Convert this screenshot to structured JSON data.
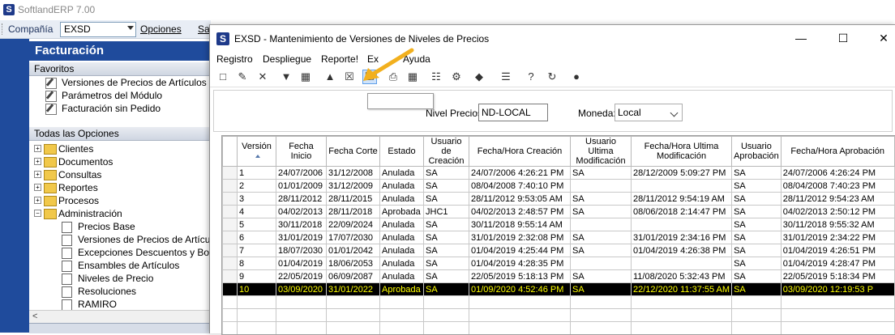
{
  "app": {
    "title": "SoftlandERP 7.00"
  },
  "company_bar": {
    "label": "Compañía",
    "value": "EXSD",
    "options": "Opciones",
    "salir": "Sa"
  },
  "nav": {
    "header": "Facturación",
    "favorites_title": "Favoritos",
    "favorites": [
      "Versiones de Precios de Artículos",
      "Parámetros del Módulo",
      "Facturación sin Pedido"
    ],
    "all_title": "Todas las Opciones",
    "tree": [
      "Clientes",
      "Documentos",
      "Consultas",
      "Reportes",
      "Procesos",
      "Administración"
    ],
    "admin_children": [
      "Precios Base",
      "Versiones de Precios de Artículo",
      "Excepciones Descuentos y Bonif",
      "Ensambles de Artículos",
      "Niveles de Precio",
      "Resoluciones",
      "RAMIRO"
    ]
  },
  "window": {
    "title": "EXSD - Mantenimiento de Versiones de Niveles de Precios",
    "menu": [
      "Registro",
      "Despliegue",
      "Reporte!",
      "Ex",
      "Ayuda"
    ],
    "filter": {
      "nivel_label": "Nivel Precios:",
      "nivel_value": "ND-LOCAL",
      "moneda_label": "Moneda:",
      "moneda_value": "Local"
    }
  },
  "grid": {
    "headers": [
      "",
      "Versión",
      "Fecha Inicio",
      "Fecha Corte",
      "Estado",
      "Usuario de Creación",
      "Fecha/Hora Creación",
      "Usuario Ultima Modificación",
      "Fecha/Hora Ultima Modificación",
      "Usuario Aprobación",
      "Fecha/Hora Aprobación"
    ],
    "rows": [
      [
        "1",
        "24/07/2006",
        "31/12/2008",
        "Anulada",
        "SA",
        "24/07/2006 4:26:21 PM",
        "SA",
        "28/12/2009 5:09:27 PM",
        "SA",
        "24/07/2006 4:26:24 PM"
      ],
      [
        "2",
        "01/01/2009",
        "31/12/2009",
        "Anulada",
        "SA",
        "08/04/2008 7:40:10 PM",
        "",
        "",
        "SA",
        "08/04/2008 7:40:23 PM"
      ],
      [
        "3",
        "28/11/2012",
        "28/11/2015",
        "Anulada",
        "SA",
        "28/11/2012 9:53:05 AM",
        "SA",
        "28/11/2012 9:54:19 AM",
        "SA",
        "28/11/2012 9:54:23 AM"
      ],
      [
        "4",
        "04/02/2013",
        "28/11/2018",
        "Aprobada",
        "JHC1",
        "04/02/2013 2:48:57 PM",
        "SA",
        "08/06/2018 2:14:47 PM",
        "SA",
        "04/02/2013 2:50:12 PM"
      ],
      [
        "5",
        "30/11/2018",
        "22/09/2024",
        "Anulada",
        "SA",
        "30/11/2018 9:55:14 AM",
        "",
        "",
        "SA",
        "30/11/2018 9:55:32 AM"
      ],
      [
        "6",
        "31/01/2019",
        "17/07/2030",
        "Anulada",
        "SA",
        "31/01/2019 2:32:08 PM",
        "SA",
        "31/01/2019 2:34:16 PM",
        "SA",
        "31/01/2019 2:34:22 PM"
      ],
      [
        "7",
        "18/07/2030",
        "01/01/2042",
        "Anulada",
        "SA",
        "01/04/2019 4:25:44 PM",
        "SA",
        "01/04/2019 4:26:38 PM",
        "SA",
        "01/04/2019 4:26:51 PM"
      ],
      [
        "8",
        "01/04/2019",
        "18/06/2053",
        "Anulada",
        "SA",
        "01/04/2019 4:28:35 PM",
        "",
        "",
        "SA",
        "01/04/2019 4:28:47 PM"
      ],
      [
        "9",
        "22/05/2019",
        "06/09/2087",
        "Anulada",
        "SA",
        "22/05/2019 5:18:13 PM",
        "SA",
        "11/08/2020 5:32:43 PM",
        "SA",
        "22/05/2019 5:18:34 PM"
      ],
      [
        "10",
        "03/09/2020",
        "31/01/2022",
        "Aprobada",
        "SA",
        "01/09/2020 4:52:46 PM",
        "SA",
        "22/12/2020 11:37:55 AM",
        "SA",
        "03/09/2020 12:19:53 P"
      ]
    ],
    "selected_row": 9,
    "empty_rows": 3
  }
}
